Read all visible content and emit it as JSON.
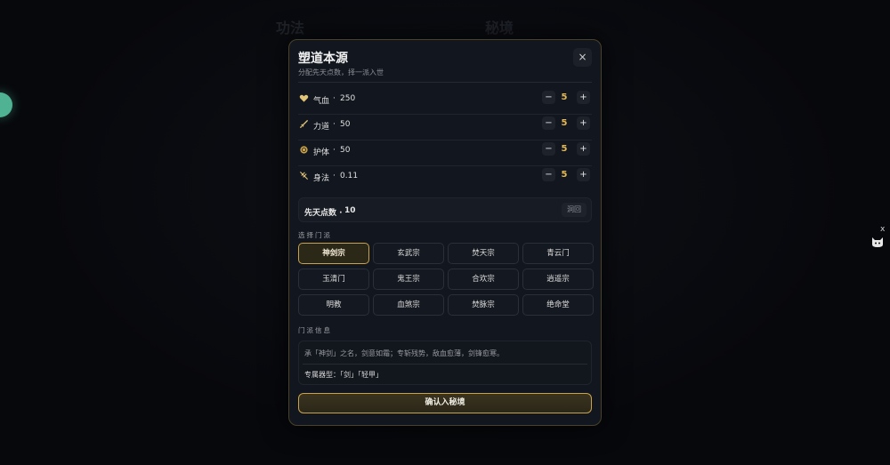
{
  "background": {
    "faint_left": "功法",
    "faint_right": "秘境"
  },
  "side_widget": {
    "close_label": "x",
    "icon": "cat-face-icon"
  },
  "dialog": {
    "title": "塑道本源",
    "subtitle": "分配先天点数，择一派入世",
    "close_label": "×",
    "stats": [
      {
        "icon": "heart-icon",
        "label": "气血",
        "separator": "·",
        "value": "250",
        "points": "5",
        "minus": "−",
        "plus": "+"
      },
      {
        "icon": "sword-icon",
        "label": "力道",
        "separator": "·",
        "value": "50",
        "points": "5",
        "minus": "−",
        "plus": "+"
      },
      {
        "icon": "shield-icon",
        "label": "护体",
        "separator": "·",
        "value": "50",
        "points": "5",
        "minus": "−",
        "plus": "+"
      },
      {
        "icon": "agility-icon",
        "label": "身法",
        "separator": "·",
        "value": "0.11",
        "points": "5",
        "minus": "−",
        "plus": "+"
      }
    ],
    "points": {
      "label": "先天点数 ·",
      "value": "10",
      "reset_label": "洞回"
    },
    "sect_section_label": "选择门派",
    "sects": [
      "神剑宗",
      "玄武宗",
      "焚天宗",
      "青云门",
      "玉清门",
      "鬼王宗",
      "合欢宗",
      "逍遥宗",
      "明教",
      "血煞宗",
      "焚脉宗",
      "绝命堂"
    ],
    "selected_sect_index": 0,
    "info_section_label": "门派信息",
    "info_description": "承「神剑」之名，剑意如霜；专斩残势，敌血愈薄，剑锋愈寒。",
    "info_weapon": "专属器型：「剑」「轻甲」",
    "confirm_label": "确认入秘境"
  },
  "colors": {
    "accent": "#c9a24a",
    "points_value": "#e3b956",
    "panel_bg": "#12161e",
    "page_bg": "#07080c"
  }
}
